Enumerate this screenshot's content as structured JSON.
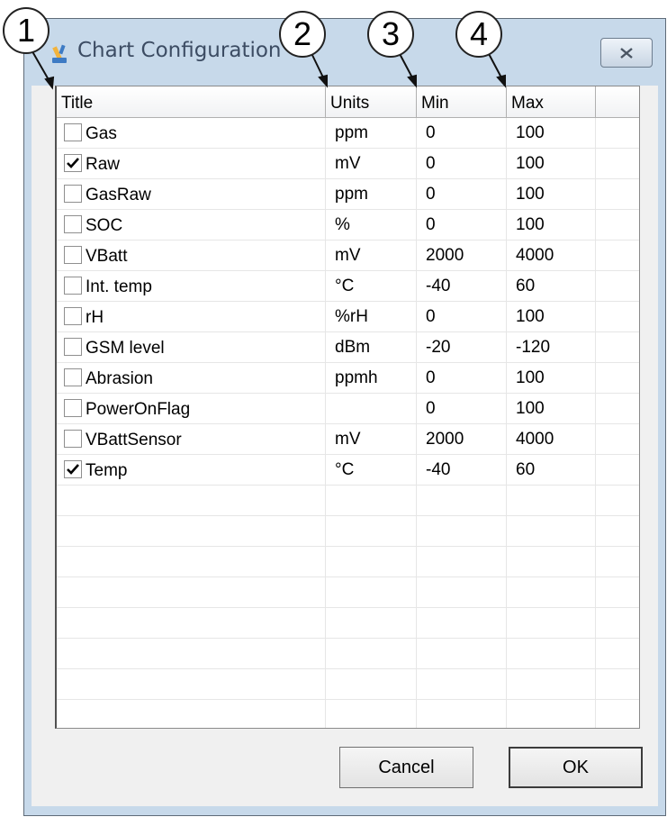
{
  "window": {
    "title": "Chart Configuration",
    "icon": "wrench-chart-icon",
    "close_icon": "close-x-icon"
  },
  "callouts": [
    "1",
    "2",
    "3",
    "4"
  ],
  "table": {
    "columns": [
      "Title",
      "Units",
      "Min",
      "Max"
    ],
    "rows": [
      {
        "checked": false,
        "title": "Gas",
        "units": "ppm",
        "min": "0",
        "max": "100"
      },
      {
        "checked": true,
        "title": "Raw",
        "units": "mV",
        "min": "0",
        "max": "100"
      },
      {
        "checked": false,
        "title": "GasRaw",
        "units": "ppm",
        "min": "0",
        "max": "100"
      },
      {
        "checked": false,
        "title": "SOC",
        "units": "%",
        "min": "0",
        "max": "100"
      },
      {
        "checked": false,
        "title": "VBatt",
        "units": "mV",
        "min": "2000",
        "max": "4000"
      },
      {
        "checked": false,
        "title": "Int. temp",
        "units": "°C",
        "min": "-40",
        "max": "60"
      },
      {
        "checked": false,
        "title": "rH",
        "units": "%rH",
        "min": "0",
        "max": "100"
      },
      {
        "checked": false,
        "title": "GSM level",
        "units": "dBm",
        "min": "-20",
        "max": "-120"
      },
      {
        "checked": false,
        "title": "Abrasion",
        "units": "ppmh",
        "min": "0",
        "max": "100"
      },
      {
        "checked": false,
        "title": "PowerOnFlag",
        "units": "",
        "min": "0",
        "max": "100"
      },
      {
        "checked": false,
        "title": "VBattSensor",
        "units": "mV",
        "min": "2000",
        "max": "4000"
      },
      {
        "checked": true,
        "title": "Temp",
        "units": "°C",
        "min": "-40",
        "max": "60"
      }
    ],
    "empty_rows": 8
  },
  "buttons": {
    "cancel": "Cancel",
    "ok": "OK"
  }
}
